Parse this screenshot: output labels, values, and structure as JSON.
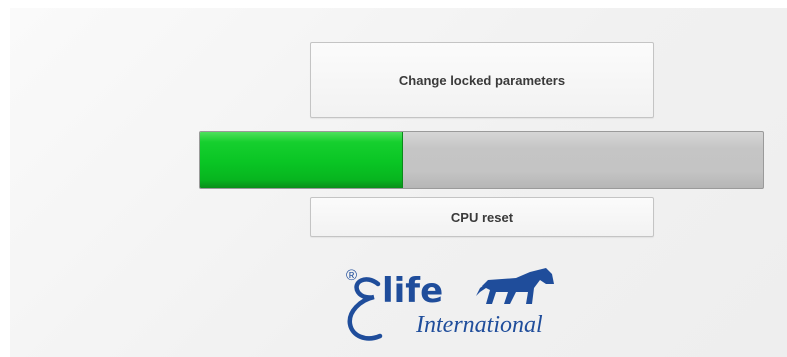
{
  "buttons": {
    "change_locked_parameters": "Change locked parameters",
    "cpu_reset": "CPU reset"
  },
  "progress": {
    "fraction": 0.36,
    "fill_color": "#0fc526",
    "track_color": "#c6c6c6"
  },
  "logo": {
    "registered": "®",
    "brand": "life",
    "subtitle": "International",
    "color": "#1f4d9b",
    "icon": "horse-icon"
  }
}
